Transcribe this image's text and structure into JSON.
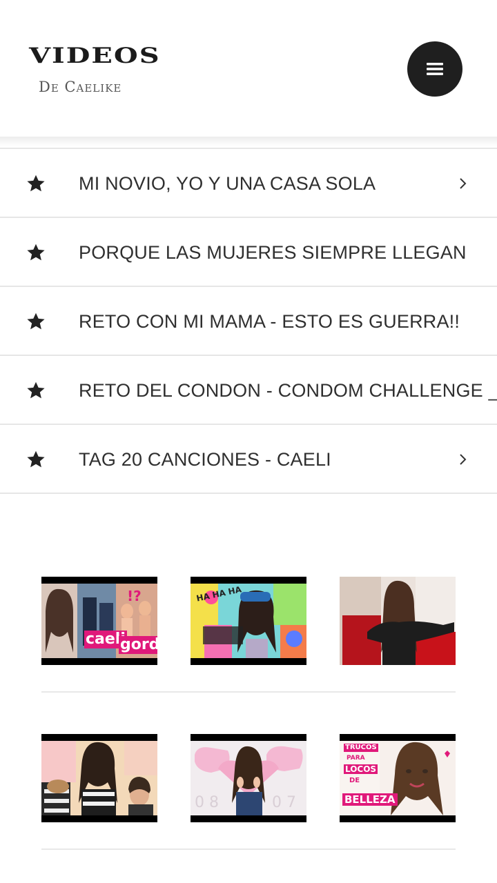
{
  "header": {
    "logo_title": "VIDEOS",
    "logo_subtitle": "De Caelike",
    "menu_icon": "hamburger-menu-icon"
  },
  "videos": [
    {
      "title": "MI NOVIO, YO Y UNA CASA SOLA",
      "chevron": true
    },
    {
      "title": "PORQUE LAS MUJERES SIEMPRE LLEGAN",
      "chevron": false
    },
    {
      "title": "RETO CON MI MAMA - ESTO ES GUERRA!!",
      "chevron": false
    },
    {
      "title": "RETO DEL CONDON - CONDOM CHALLENGE _",
      "chevron": false
    },
    {
      "title": "TAG 20 CANCIONES - CAELI",
      "chevron": true
    }
  ],
  "thumbnails": {
    "t1_text_a": "caeli",
    "t1_text_b": "gorda",
    "t1_text_c": "!?",
    "t2_text_a": "HA HA HA",
    "t6_text_a": "TRUCOS",
    "t6_text_b": "PARA",
    "t6_text_c": "LOCOS",
    "t6_text_d": "DE",
    "t6_text_e": "BELLEZA"
  },
  "colors": {
    "accent_dark": "#1f1f1f",
    "divider": "#e6e6e6",
    "text": "#2f2f2f",
    "pink": "#e0197a"
  }
}
